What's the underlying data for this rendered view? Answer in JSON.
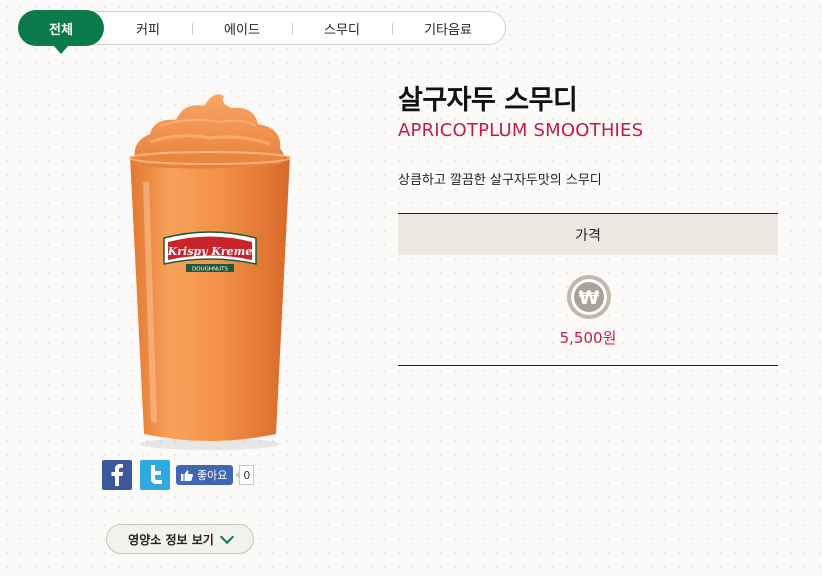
{
  "tabs": [
    {
      "label": "전체",
      "active": true
    },
    {
      "label": "커피"
    },
    {
      "label": "에이드"
    },
    {
      "label": "스무디"
    },
    {
      "label": "기타음료"
    }
  ],
  "product": {
    "name_ko": "살구자두 스무디",
    "name_en": "APRICOTPLUM SMOOTHIES",
    "description": "상큼하고 깔끔한 살구자두맛의 스무디",
    "price_header": "가격",
    "price": "5,500원",
    "cup_logo_top": "Krispy Kreme",
    "cup_logo_bottom": "DOUGHNUTS"
  },
  "social": {
    "like_label": "좋아요",
    "like_count": "0"
  },
  "nutrition_button": "영양소 정보 보기",
  "colors": {
    "accent_green": "#0a7a4a",
    "price_red": "#c21a4a",
    "facebook": "#3b5998",
    "twitter": "#2fa9e0"
  }
}
